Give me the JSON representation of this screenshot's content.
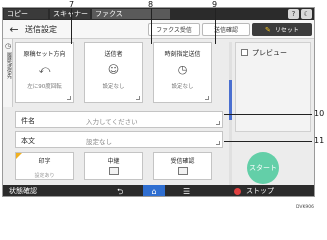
{
  "topbar": {
    "tabs": [
      "コピー",
      "スキャナー",
      "ファクス"
    ],
    "icons": [
      "help-icon",
      "moon-icon"
    ]
  },
  "titlebar": {
    "back_icon": "back-arrow-icon",
    "title": "送信設定",
    "buttons": [
      "ファクス受信",
      "送信確認",
      "リセット"
    ]
  },
  "sidetab": {
    "label": "履歴/送信先"
  },
  "tiles": [
    {
      "label": "原稿セット方向",
      "value": "左に90度回転"
    },
    {
      "label": "送信者",
      "value": "設定なし"
    },
    {
      "label": "時刻指定送信",
      "value": "設定なし"
    }
  ],
  "preview": {
    "label": "プレビュー",
    "checked": false
  },
  "rows": [
    {
      "label": "件名",
      "value": "入力してください"
    },
    {
      "label": "本文",
      "value": "設定なし"
    }
  ],
  "bottom_tiles": [
    {
      "label": "印字",
      "sub": "設定あり"
    },
    {
      "label": "中継",
      "sub": ""
    },
    {
      "label": "受信確認",
      "sub": ""
    }
  ],
  "start_label": "スタート",
  "bottombar": {
    "status": "状態確認",
    "stop": "ストップ"
  },
  "callouts": [
    "7",
    "8",
    "9",
    "10",
    "11"
  ],
  "image_code": "DVK906",
  "colors": {
    "accent": "#2f6ed0",
    "start": "#63cfa8",
    "reset": "#3c3c3c",
    "stop": "#e04040"
  }
}
